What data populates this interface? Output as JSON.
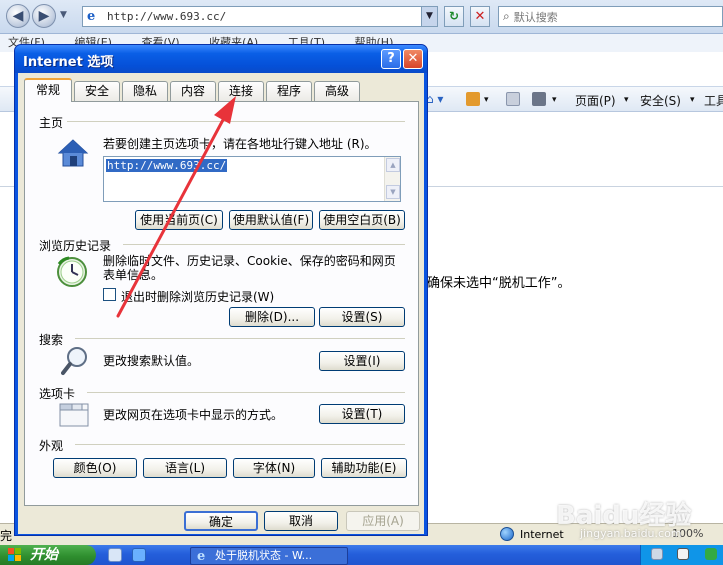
{
  "browser": {
    "address": "http://www.693.cc/",
    "search_placeholder": "默认搜索",
    "menu_items": [
      "文件(F)",
      "编辑(E)",
      "查看(V)",
      "收藏夹(A)",
      "工具(T)",
      "帮助(H)"
    ],
    "command_bar": {
      "page_label": "页面(P)",
      "safety_label": "安全(S)",
      "tools_label": "工具"
    },
    "content_text": "确保未选中“脱机工作”。",
    "status_left": "完",
    "status_zone": "Internet",
    "status_zoom": "100%"
  },
  "taskbar": {
    "start_label": "开始",
    "task_label": "处于脱机状态 - W..."
  },
  "watermark": {
    "brand": "Baidu经验",
    "sub": "jingyan.baidu.com"
  },
  "dialog": {
    "title": "Internet 选项",
    "help_label": "?",
    "close_label": "✕",
    "tabs": [
      {
        "label": "常规"
      },
      {
        "label": "安全"
      },
      {
        "label": "隐私"
      },
      {
        "label": "内容"
      },
      {
        "label": "连接"
      },
      {
        "label": "程序"
      },
      {
        "label": "高级"
      }
    ],
    "homepage": {
      "section": "主页",
      "description": "若要创建主页选项卡，请在各地址行键入地址 (R)。",
      "url": "http://www.693.cc/",
      "btn_current": "使用当前页(C)",
      "btn_default": "使用默认值(F)",
      "btn_blank": "使用空白页(B)"
    },
    "history": {
      "section": "浏览历史记录",
      "description_line1": "删除临时文件、历史记录、Cookie、保存的密码和网页",
      "description_line2": "表单信息。",
      "checkbox_label": "退出时删除浏览历史记录(W)",
      "btn_delete": "删除(D)...",
      "btn_settings": "设置(S)"
    },
    "search": {
      "section": "搜索",
      "description": "更改搜索默认值。",
      "btn_settings": "设置(I)"
    },
    "tabsection": {
      "section": "选项卡",
      "description": "更改网页在选项卡中显示的方式。",
      "btn_settings": "设置(T)"
    },
    "appearance": {
      "section": "外观",
      "btn_colors": "颜色(O)",
      "btn_languages": "语言(L)",
      "btn_fonts": "字体(N)",
      "btn_accessibility": "辅助功能(E)"
    },
    "footer": {
      "ok": "确定",
      "cancel": "取消",
      "apply": "应用(A)"
    }
  },
  "colors": {
    "xp_blue": "#0a54e0",
    "dialog_face": "#ece9d8",
    "active_tab_accent": "#f0a53a",
    "annotation_arrow": "#e8333a"
  }
}
